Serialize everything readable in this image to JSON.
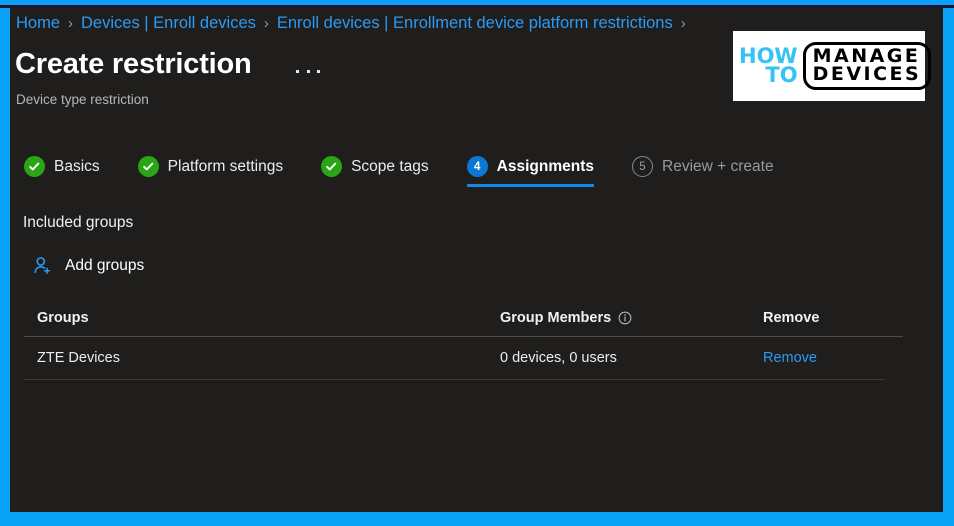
{
  "theme": {
    "frame_color": "#0aa2f7",
    "page_background": "#1f1e1d",
    "link_color": "#2b9af3",
    "accent_blue": "#0a78d4",
    "done_green": "#2aa515"
  },
  "breadcrumb": {
    "name": "breadcrumb",
    "items": [
      {
        "label": "Home"
      },
      {
        "label": "Devices | Enroll devices"
      },
      {
        "label": "Enroll devices | Enrollment device platform restrictions"
      }
    ],
    "separator": "›"
  },
  "header": {
    "title": "Create restriction",
    "subtitle": "Device type restriction",
    "more_menu": "···"
  },
  "logo": {
    "how": "HOW",
    "to": "TO",
    "manage": "MANAGE",
    "devices": "DEVICES"
  },
  "wizard": {
    "steps": [
      {
        "number": "1",
        "label": "Basics",
        "state": "done",
        "icon": "check-icon"
      },
      {
        "number": "2",
        "label": "Platform settings",
        "state": "done",
        "icon": "check-icon"
      },
      {
        "number": "3",
        "label": "Scope tags",
        "state": "done",
        "icon": "check-icon"
      },
      {
        "number": "4",
        "label": "Assignments",
        "state": "active",
        "icon": ""
      },
      {
        "number": "5",
        "label": "Review + create",
        "state": "todo",
        "icon": ""
      }
    ]
  },
  "main": {
    "section_title": "Included groups",
    "add_groups_label": "Add groups",
    "add_groups_icon": "add-user-icon",
    "table": {
      "columns": [
        {
          "key": "groups",
          "label": "Groups"
        },
        {
          "key": "members",
          "label": "Group Members",
          "icon": "info-icon"
        },
        {
          "key": "remove",
          "label": "Remove"
        }
      ],
      "rows": [
        {
          "group": "ZTE Devices",
          "members": "0 devices, 0 users",
          "remove_label": "Remove"
        }
      ]
    }
  }
}
